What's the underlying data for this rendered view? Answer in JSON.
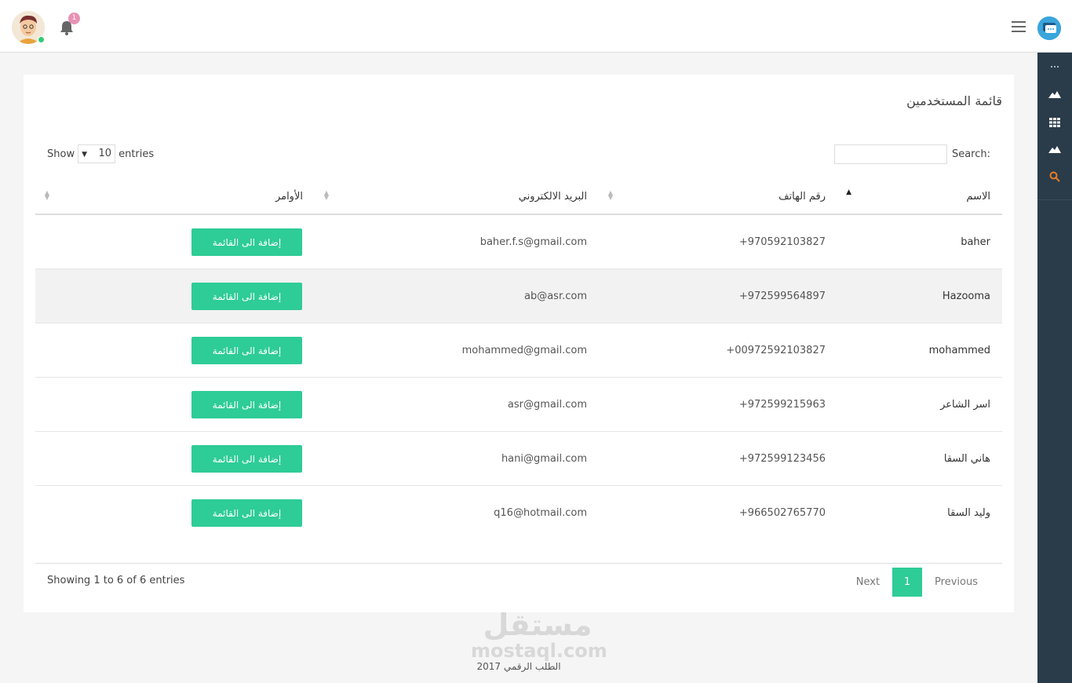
{
  "header": {
    "notification_count": "1",
    "avatar_icon": "user-avatar",
    "bell_icon": "bell-icon",
    "menu_icon": "hamburger-icon",
    "logo_icon": "chat-logo-icon"
  },
  "sidebar": {
    "items": [
      {
        "icon": "more-dots-icon"
      },
      {
        "icon": "mountain-icon"
      },
      {
        "icon": "grid-icon"
      },
      {
        "icon": "mountain-icon"
      },
      {
        "icon": "search-icon",
        "color": "#e67e22"
      }
    ]
  },
  "card": {
    "title": "قائمة المستخدمين",
    "show_label": "Show",
    "entries_label": "entries",
    "page_size": "10",
    "search_label": "Search:",
    "search_value": ""
  },
  "table": {
    "columns": {
      "name": "الاسم",
      "phone": "رقم الهاتف",
      "email": "البريد الالكتروني",
      "actions": "الأوامر"
    },
    "rows": [
      {
        "name": "baher",
        "phone": "+970592103827",
        "email": "baher.f.s@gmail.com",
        "action": "إضافة الى القائمة"
      },
      {
        "name": "Hazooma",
        "phone": "+972599564897",
        "email": "ab@asr.com",
        "action": "إضافة الى القائمة"
      },
      {
        "name": "mohammed",
        "phone": "+00972592103827",
        "email": "mohammed@gmail.com",
        "action": "إضافة الى القائمة"
      },
      {
        "name": "اسر الشاعر",
        "phone": "+972599215963",
        "email": "asr@gmail.com",
        "action": "إضافة الى القائمة"
      },
      {
        "name": "هاني السقا",
        "phone": "+972599123456",
        "email": "hani@gmail.com",
        "action": "إضافة الى القائمة"
      },
      {
        "name": "وليد السقا",
        "phone": "+966502765770",
        "email": "q16@hotmail.com",
        "action": "إضافة الى القائمة"
      }
    ]
  },
  "footer_table": {
    "info": "Showing 1 to 6 of 6 entries",
    "previous": "Previous",
    "current_page": "1",
    "next": "Next"
  },
  "watermark": {
    "line1": "مستقل",
    "line2": "mostaql.com"
  },
  "footer": {
    "copyright": "الطلب الرقمي 2017"
  },
  "colors": {
    "accent": "#2ecc96",
    "sidebar": "#2a3b4a",
    "badge": "#e891b4"
  }
}
